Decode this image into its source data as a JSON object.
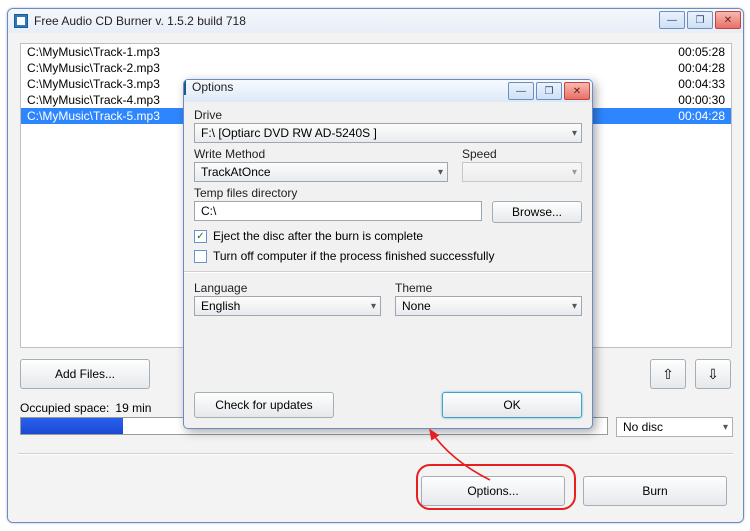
{
  "main_window": {
    "title": "Free Audio CD Burner  v. 1.5.2 build 718",
    "tracks": [
      {
        "path": "C:\\MyMusic\\Track-1.mp3",
        "duration": "00:05:28",
        "selected": false
      },
      {
        "path": "C:\\MyMusic\\Track-2.mp3",
        "duration": "00:04:28",
        "selected": false
      },
      {
        "path": "C:\\MyMusic\\Track-3.mp3",
        "duration": "00:04:33",
        "selected": false
      },
      {
        "path": "C:\\MyMusic\\Track-4.mp3",
        "duration": "00:00:30",
        "selected": false
      },
      {
        "path": "C:\\MyMusic\\Track-5.mp3",
        "duration": "00:04:28",
        "selected": true
      }
    ],
    "add_files_label": "Add Files...",
    "move_up_glyph": "⇧",
    "move_down_glyph": "⇩",
    "occupied_label": "Occupied space:",
    "occupied_value": "19 min",
    "disc_selector_value": "No disc",
    "options_label": "Options...",
    "burn_label": "Burn"
  },
  "dialog": {
    "title": "Options",
    "drive_label": "Drive",
    "drive_value": "F:\\ [Optiarc DVD RW AD-5240S ]",
    "write_method_label": "Write Method",
    "write_method_value": "TrackAtOnce",
    "speed_label": "Speed",
    "speed_value": "",
    "temp_label": "Temp files directory",
    "temp_value": "C:\\",
    "browse_label": "Browse...",
    "eject_label": "Eject the disc after the burn is complete",
    "eject_checked": true,
    "shutdown_label": "Turn off computer if the process finished successfully",
    "shutdown_checked": false,
    "language_label": "Language",
    "language_value": "English",
    "theme_label": "Theme",
    "theme_value": "None",
    "check_updates_label": "Check for updates",
    "ok_label": "OK"
  },
  "glyphs": {
    "min": "—",
    "max": "❐",
    "close": "✕",
    "caret": "▾",
    "check": "✓"
  }
}
